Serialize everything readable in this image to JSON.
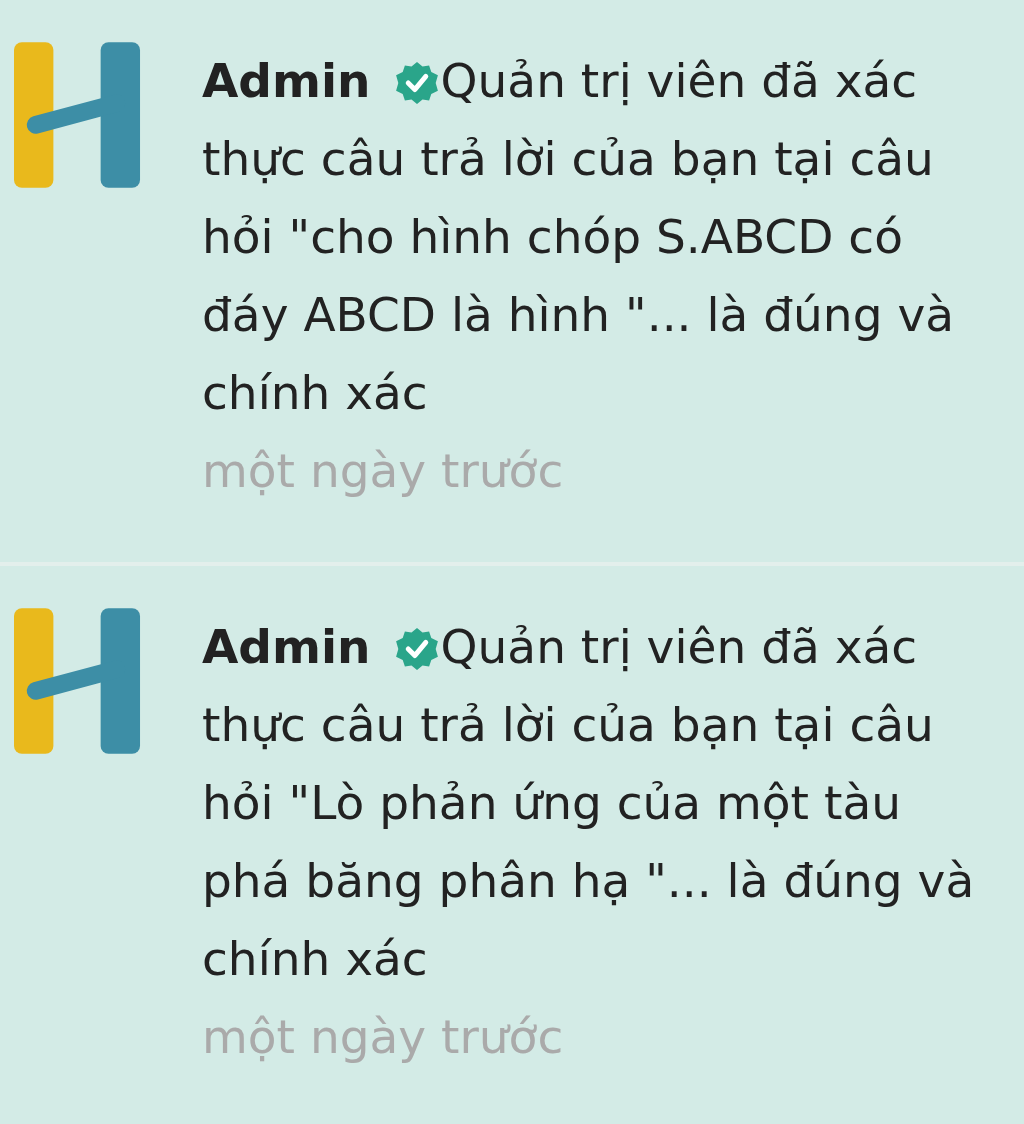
{
  "notifications": [
    {
      "author": "Admin",
      "verified": true,
      "message": "Quản trị viên đã xác thực câu trả lời của bạn tại câu hỏi \"cho hình chóp S.ABCD có đáy ABCD là hình \"... là đúng và chính xác",
      "time": "một ngày trước"
    },
    {
      "author": "Admin",
      "verified": true,
      "message": "Quản trị viên đã xác thực câu trả lời của bạn tại câu hỏi \"Lò phản ứng của một tàu phá băng phân hạ \"... là đúng và chính xác",
      "time": "một ngày trước"
    }
  ]
}
